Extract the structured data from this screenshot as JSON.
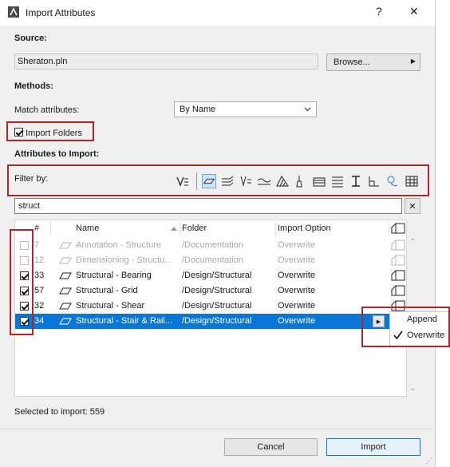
{
  "window": {
    "title": "Import Attributes",
    "help": "?",
    "close": "✕"
  },
  "source": {
    "label": "Source:",
    "value": "Sheraton.pln",
    "browse": "Browse..."
  },
  "methods": {
    "label": "Methods:",
    "match_label": "Match attributes:",
    "match_value": "By Name",
    "import_folders": "Import Folders"
  },
  "attrs": {
    "label": "Attributes to Import:",
    "filter_label": "Filter by:"
  },
  "search": {
    "value": "struct",
    "clear": "✕"
  },
  "table": {
    "headers": {
      "num": "#",
      "name": "Name",
      "folder": "Folder",
      "option": "Import Option"
    },
    "rows": [
      {
        "checked": false,
        "num": "7",
        "name": "Annotation - Structure",
        "folder": "/Documentation",
        "option": "Overwrite",
        "dim": true,
        "selected": false
      },
      {
        "checked": false,
        "num": "12",
        "name": "Dimensioning - Structu...",
        "folder": "/Documentation",
        "option": "Overwrite",
        "dim": true,
        "selected": false
      },
      {
        "checked": true,
        "num": "33",
        "name": "Structural - Bearing",
        "folder": "/Design/Structural",
        "option": "Overwrite",
        "dim": false,
        "selected": false
      },
      {
        "checked": true,
        "num": "57",
        "name": "Structural - Grid",
        "folder": "/Design/Structural",
        "option": "Overwrite",
        "dim": false,
        "selected": false
      },
      {
        "checked": true,
        "num": "32",
        "name": "Structural - Shear",
        "folder": "/Design/Structural",
        "option": "Overwrite",
        "dim": false,
        "selected": false
      },
      {
        "checked": true,
        "num": "34",
        "name": "Structural - Stair & Rail...",
        "folder": "/Design/Structural",
        "option": "Overwrite",
        "dim": false,
        "selected": true
      }
    ]
  },
  "popup": {
    "items": [
      "Append",
      "Overwrite"
    ],
    "checked_item": "Overwrite"
  },
  "footer": {
    "selected_text": "Selected to import: 559",
    "cancel": "Cancel",
    "import": "Import"
  },
  "colors": {
    "selection": "#0a77d8",
    "highlight_border": "#b0262b"
  }
}
